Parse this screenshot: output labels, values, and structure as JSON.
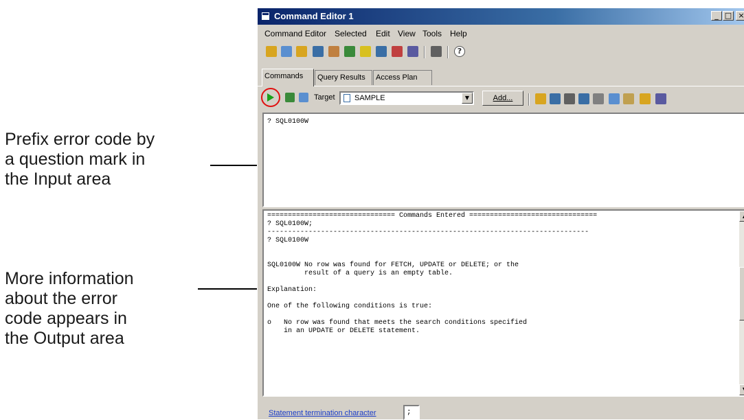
{
  "annotations": {
    "input_note": "Prefix error code by\na question mark in\nthe Input area",
    "output_note": "More information\nabout the error\ncode appears in\nthe Output area"
  },
  "window": {
    "title": "Command Editor 1",
    "title_icon": "window-app-icon",
    "controls": {
      "minimize": "_",
      "maximize": "□",
      "close": "×"
    }
  },
  "menu": [
    "Command Editor",
    "Selected",
    "Edit",
    "View",
    "Tools",
    "Help"
  ],
  "toolbar1": {
    "icons": [
      {
        "name": "control-center-icon",
        "color": "#d8a520"
      },
      {
        "name": "replication-center-icon",
        "color": "#5a8fd0"
      },
      {
        "name": "satellite-admin-icon",
        "color": "#d8a520"
      },
      {
        "name": "command-editor-icon",
        "color": "#3a6ea5"
      },
      {
        "name": "task-center-icon",
        "color": "#c08040"
      },
      {
        "name": "health-center-icon",
        "color": "#3a8a3a"
      },
      {
        "name": "journal-icon",
        "color": "#d8c020"
      },
      {
        "name": "license-center-icon",
        "color": "#3a6ea5"
      },
      {
        "name": "development-center-icon",
        "color": "#c04040"
      },
      {
        "name": "configuration-assistant-icon",
        "color": "#5a5aa0"
      },
      {
        "name": "tools-settings-icon",
        "color": "#606060"
      }
    ],
    "help_glyph": "?"
  },
  "tabs": [
    "Commands",
    "Query Results",
    "Access Plan"
  ],
  "toolbar2": {
    "run_icon": "run-play-icon",
    "target_label": "Target",
    "target_value": "SAMPLE",
    "add_label": "Add...",
    "icons": [
      {
        "name": "open-icon",
        "color": "#d8a520"
      },
      {
        "name": "save-icon",
        "color": "#3a6ea5"
      },
      {
        "name": "print-icon",
        "color": "#606060"
      },
      {
        "name": "find-icon",
        "color": "#3a6ea5"
      },
      {
        "name": "cut-icon",
        "color": "#808080"
      },
      {
        "name": "copy-icon",
        "color": "#5a8fd0"
      },
      {
        "name": "paste-icon",
        "color": "#c0a050"
      },
      {
        "name": "options-icon",
        "color": "#d8a520"
      },
      {
        "name": "memo-icon",
        "color": "#5a5aa0"
      }
    ]
  },
  "input_text": "? SQL0100W",
  "output_text": "=============================== Commands Entered ===============================\n? SQL0100W;\n------------------------------------------------------------------------------\n? SQL0100W\n\n\nSQL0100W No row was found for FETCH, UPDATE or DELETE; or the\n         result of a query is an empty table.\n\nExplanation:\n\nOne of the following conditions is true:\n\no   No row was found that meets the search conditions specified\n    in an UPDATE or DELETE statement.",
  "status": {
    "link_label": "Statement termination character",
    "term_value": ";"
  }
}
